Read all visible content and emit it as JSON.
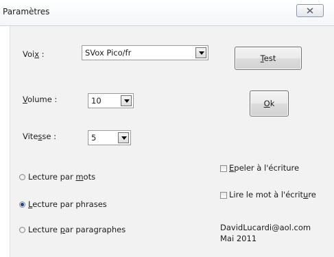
{
  "window": {
    "title": "Paramètres"
  },
  "voix": {
    "label_pre": "Voi",
    "label_key": "x",
    "label_post": " :",
    "value": "SVox Pico/fr"
  },
  "volume": {
    "label_key": "V",
    "label_post": "olume :",
    "value": "10"
  },
  "vitesse": {
    "label_pre": "Vite",
    "label_key": "s",
    "label_post": "se :",
    "value": "5"
  },
  "buttons": {
    "test": {
      "key": "T",
      "rest": "est"
    },
    "ok": {
      "key": "O",
      "rest": "k"
    }
  },
  "reading_modes": {
    "selected": "phrases",
    "mots": {
      "pre": "Lecture par ",
      "key": "m",
      "post": "ots"
    },
    "phrases": {
      "pre": "",
      "key": "L",
      "post": "ecture par phrases"
    },
    "paragraphes": {
      "pre": "Lecture ",
      "key": "p",
      "post": "ar paragraphes"
    }
  },
  "options": {
    "epeler": {
      "key": "E",
      "post": "peler à l'écriture",
      "checked": false
    },
    "lire_mot": {
      "pre": "Lire le mot à l'écrit",
      "key": "u",
      "post": "re",
      "checked": false
    }
  },
  "footer": {
    "author": "DavidLucardi@aol.com",
    "date": "Mai 2011"
  },
  "icons": {
    "close": "close-icon",
    "dropdown": "chevron-down-icon"
  },
  "colors": {
    "radio_selected": "#1f3f8f",
    "content_bg": "#f2f2f2"
  }
}
